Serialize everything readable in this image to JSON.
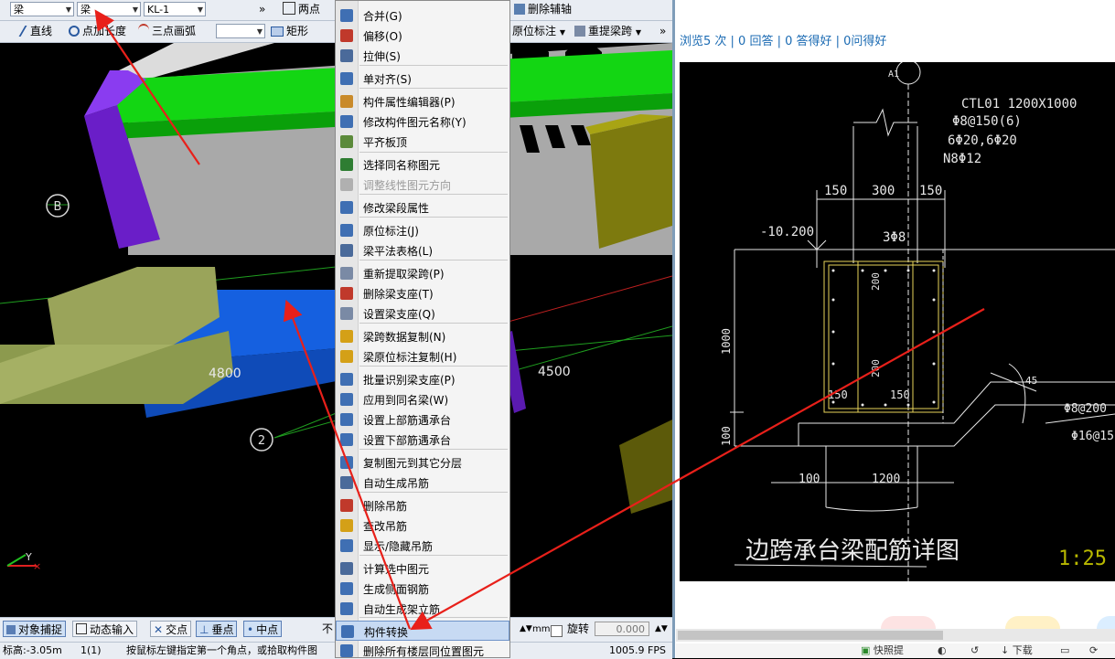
{
  "toolbar1": {
    "combo1": "梁",
    "combo2": "梁",
    "combo3": "KL-1",
    "more": "»",
    "two_point": "两点",
    "delete_aux": "删除辅轴"
  },
  "toolbar2": {
    "line": "直线",
    "point_length": "点加长度",
    "three_point_arc": "三点画弧",
    "rect": "矩形",
    "original_annot": "原位标注",
    "re_extract_span": "重提梁跨",
    "more": "»"
  },
  "viewport": {
    "axis_b": "B",
    "axis_2": "2",
    "dim_4800": "4800",
    "dim_4500": "4500",
    "axis_y": "Y"
  },
  "statusbar": {
    "snap": "对象捕捉",
    "dynamic_input": "动态输入",
    "intersection": "交点",
    "perpendicular": "垂点",
    "midpoint": "中点",
    "not_label": "不",
    "mm": "mm",
    "rotate": "旋转",
    "rotate_value": "0.000",
    "elevation": "标高:-3.05m",
    "layer": "1(1)",
    "prompt": "按鼠标左键指定第一个角点，或拾取构件图",
    "fps": "1005.9 FPS"
  },
  "context_menu": {
    "items": [
      {
        "label": "合并(G)",
        "icon": "merge-icon",
        "color": "#3f6fb3"
      },
      {
        "label": "偏移(O)",
        "icon": "offset-icon",
        "color": "#c0392b"
      },
      {
        "label": "拉伸(S)",
        "icon": "stretch-icon",
        "color": "#4a6a9a"
      },
      {
        "label": "单对齐(S)",
        "icon": "align-icon",
        "color": "#3f6fb3"
      },
      {
        "label": "构件属性编辑器(P)",
        "icon": "property-editor-icon",
        "color": "#c98a2a"
      },
      {
        "label": "修改构件图元名称(Y)",
        "icon": "rename-icon",
        "color": "#3f6fb3"
      },
      {
        "label": "平齐板顶",
        "icon": "slab-top-icon",
        "color": "#5b8a3a"
      },
      {
        "label": "选择同名称图元",
        "icon": "select-same-icon",
        "color": "#2e7d32"
      },
      {
        "label": "调整线性图元方向",
        "icon": "direction-icon",
        "color": "#b0b0b0",
        "disabled": true
      },
      {
        "label": "修改梁段属性",
        "icon": "beam-segment-icon",
        "color": "#3f6fb3"
      },
      {
        "label": "原位标注(J)",
        "icon": "annotation-icon",
        "color": "#3f6fb3"
      },
      {
        "label": "梁平法表格(L)",
        "icon": "table-icon",
        "color": "#4a6a9a"
      },
      {
        "label": "重新提取梁跨(P)",
        "icon": "re-extract-icon",
        "color": "#7a8aa5"
      },
      {
        "label": "删除梁支座(T)",
        "icon": "delete-support-icon",
        "color": "#c0392b"
      },
      {
        "label": "设置梁支座(Q)",
        "icon": "set-support-icon",
        "color": "#7a8aa5"
      },
      {
        "label": "梁跨数据复制(N)",
        "icon": "copy-span-icon",
        "color": "#d4a017"
      },
      {
        "label": "梁原位标注复制(H)",
        "icon": "copy-annot-icon",
        "color": "#d4a017"
      },
      {
        "label": "批量识别梁支座(P)",
        "icon": "batch-identify-icon",
        "color": "#3f6fb3"
      },
      {
        "label": "应用到同名梁(W)",
        "icon": "apply-same-icon",
        "color": "#3f6fb3"
      },
      {
        "label": "设置上部筋遇承台",
        "icon": "top-rebar-icon",
        "color": "#3f6fb3"
      },
      {
        "label": "设置下部筋遇承台",
        "icon": "bottom-rebar-icon",
        "color": "#3f6fb3"
      },
      {
        "label": "复制图元到其它分层",
        "icon": "copy-layer-icon",
        "color": "#3f6fb3"
      },
      {
        "label": "自动生成吊筋",
        "icon": "auto-hanger-icon",
        "color": "#4a6a9a"
      },
      {
        "label": "删除吊筋",
        "icon": "delete-hanger-icon",
        "color": "#c0392b"
      },
      {
        "label": "查改吊筋",
        "icon": "edit-hanger-icon",
        "color": "#d4a017"
      },
      {
        "label": "显示/隐藏吊筋",
        "icon": "toggle-hanger-icon",
        "color": "#3f6fb3"
      },
      {
        "label": "计算选中图元",
        "icon": "calculate-icon",
        "color": "#4a6a9a"
      },
      {
        "label": "生成侧面钢筋",
        "icon": "side-rebar-icon",
        "color": "#3f6fb3"
      },
      {
        "label": "自动生成架立筋",
        "icon": "erection-rebar-icon",
        "color": "#3f6fb3"
      },
      {
        "label": "构件转换",
        "icon": "convert-icon",
        "color": "#3f6fb3",
        "highlighted": true
      },
      {
        "label": "删除所有楼层同位置图元",
        "icon": "delete-all-floors-icon",
        "color": "#3f6fb3"
      }
    ]
  },
  "right_panel": {
    "stats": "浏览5 次 | 0 回答 | 0 答得好 | 0问得好",
    "bottom_share": "快照提",
    "bottom_download": "下载"
  },
  "cad": {
    "axis": "A1",
    "title_line1": "CTL01 1200X1000",
    "title_line2": "Φ8@150(6)",
    "title_line3": "6Φ20,6Φ20",
    "title_line4": "N8Φ12",
    "dim_150a": "150",
    "dim_300": "300",
    "dim_150b": "150",
    "elev": "-10.200",
    "rebar_3phi8": "3Φ8",
    "dim_200a": "200",
    "dim_200b": "200",
    "dim_1000": "1000",
    "dim_150c": "150",
    "dim_150d": "150",
    "dim_100": "100",
    "dim_100b": "100",
    "dim_1200": "1200",
    "rebar_phi8_200": "Φ8@200",
    "rebar_phi16_15": "Φ16@15",
    "angle_45": "45",
    "drawing_title": "边跨承台梁配筋详图",
    "scale": "1:25"
  }
}
